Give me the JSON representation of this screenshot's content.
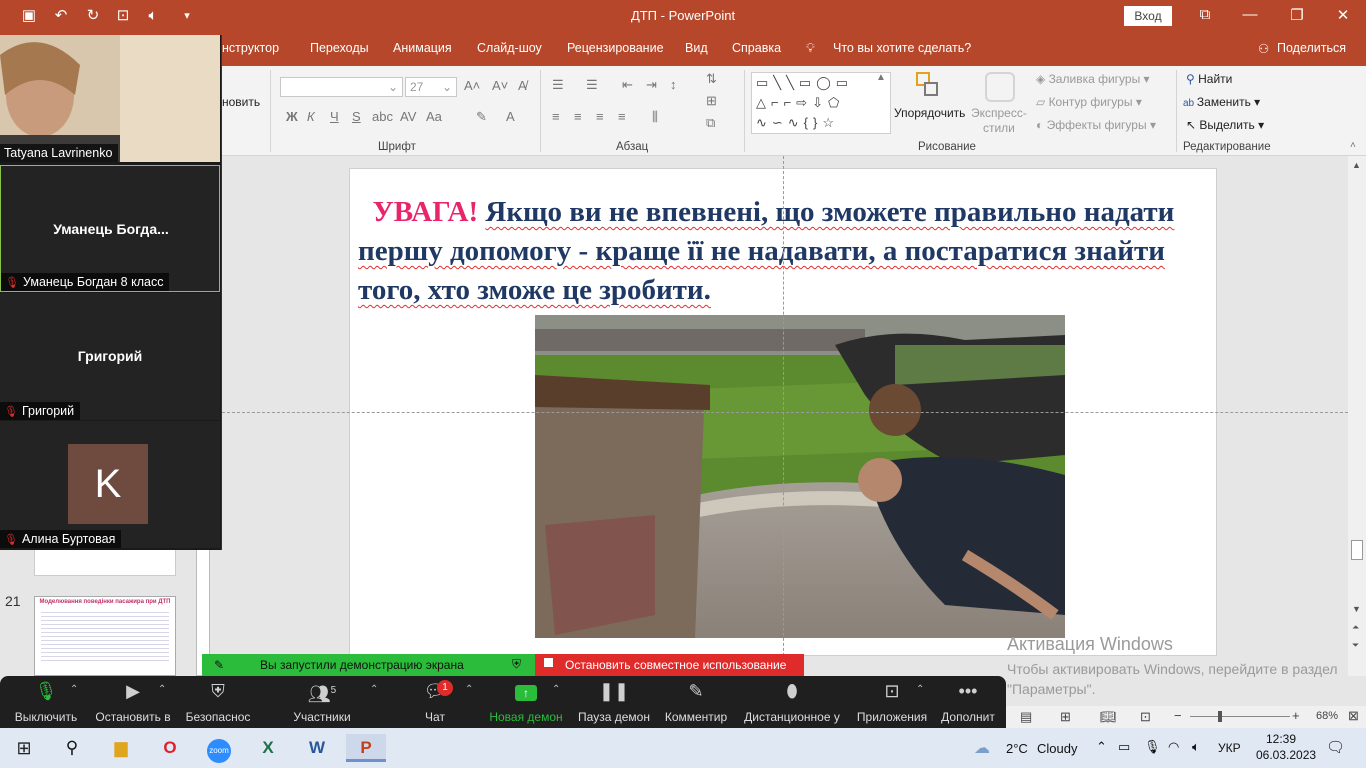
{
  "window": {
    "title": "ДТП  -  PowerPoint",
    "signin": "Вход"
  },
  "tabs": [
    "нструктор",
    "Переходы",
    "Анимация",
    "Слайд-шоу",
    "Рецензирование",
    "Вид",
    "Справка",
    "Что вы хотите сделать?",
    "Поделиться"
  ],
  "ribbon": {
    "clipboard_partial": "новить",
    "font": {
      "size": "27",
      "group_label": "Шрифт"
    },
    "paragraph": {
      "group_label": "Абзац"
    },
    "drawing": {
      "arrange": "Упорядочить",
      "quick_styles": "Экспресс-\nстили",
      "fill": "Заливка фигуры",
      "outline": "Контур фигуры",
      "effects": "Эффекты фигуры",
      "group_label": "Рисование"
    },
    "editing": {
      "find": "Найти",
      "replace": "Заменить",
      "select": "Выделить",
      "group_label": "Редактирование"
    }
  },
  "slide": {
    "warning": "УВАГА!",
    "text": "Якщо ви не впевнені, що зможете правильно надати першу допомогу - краще її не надавати, а постаратися знайти того, хто зможе це зробити."
  },
  "thumbnails": {
    "slide_number": "21",
    "thumb_title": "Моделювання поведінки пасажира при ДТП"
  },
  "activation": {
    "title": "Активация Windows",
    "text": "Чтобы активировать Windows, перейдите в раздел \"Параметры\"."
  },
  "zoom": {
    "participants": [
      {
        "name": "Tatyana Lavrinenko",
        "center": ""
      },
      {
        "name": "Уманець Богдан 8 класс",
        "center": "Уманець  Богда..."
      },
      {
        "name": "Григорий",
        "center": "Григорий"
      },
      {
        "name": "Алина Буртовая",
        "center": "",
        "avatar_letter": "K"
      }
    ],
    "share_notice": "Вы запустили демонстрацию экрана",
    "stop_share": "Остановить совместное использование",
    "toolbar": {
      "mute": "Выключить",
      "video": "Остановить в",
      "security": "Безопаснос",
      "participants": "Участники",
      "participants_count": "5",
      "chat": "Чат",
      "chat_badge": "1",
      "new_share": "Новая демон",
      "pause_share": "Пауза демон",
      "annotate": "Комментир",
      "remote": "Дистанционное у",
      "apps": "Приложения",
      "more": "Дополнит"
    }
  },
  "statusbar": {
    "zoom": "68%"
  },
  "taskbar": {
    "weather_temp": "2°C",
    "weather_text": "Cloudy",
    "lang": "УКР",
    "time": "12:39",
    "date": "06.03.2023"
  },
  "colors": {
    "accent": "#b7472a",
    "warning": "#e8246a",
    "text": "#1f3864",
    "zoom_green": "#2bbc3b",
    "zoom_red": "#e02b2b"
  }
}
